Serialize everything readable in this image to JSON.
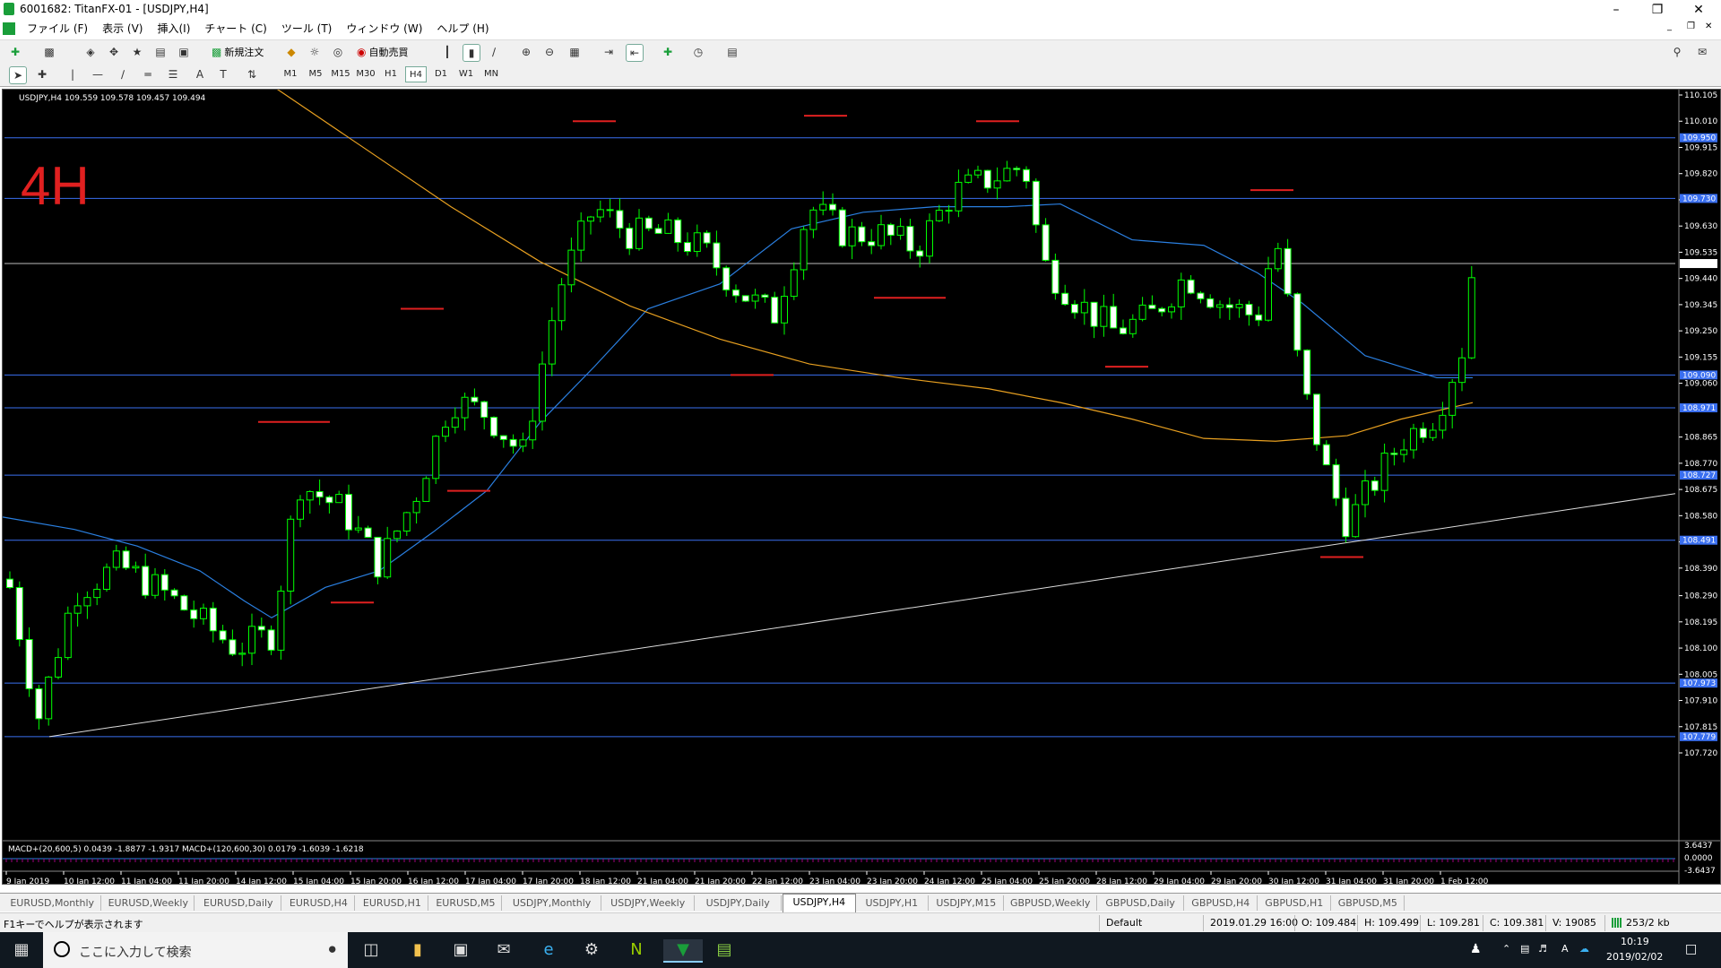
{
  "window": {
    "title": "6001682: TitanFX-01 - [USDJPY,H4]"
  },
  "menu": [
    "ファイル (F)",
    "表示 (V)",
    "挿入(I)",
    "チャート (C)",
    "ツール (T)",
    "ウィンドウ (W)",
    "ヘルプ (H)"
  ],
  "toolbar": {
    "new_order": "新規注文",
    "auto_trade": "自動売買"
  },
  "timeframes": [
    "M1",
    "M5",
    "M15",
    "M30",
    "H1",
    "H4",
    "D1",
    "W1",
    "MN"
  ],
  "active_timeframe": "H4",
  "chart": {
    "header": "USDJPY,H4  109.559 109.578 109.457 109.494",
    "overlay_text": "4H",
    "overlay_color": "#e02020",
    "macd_header": "MACD+(20,600,5) 0.0439 -1.8877 -1.9317  MACD+(120,600,30) 0.0179 -1.6039 -1.6218",
    "bull_color": "#00ff00",
    "bear_color": "#00ff00",
    "price_axis": [
      "110.105",
      "110.010",
      "109.915",
      "109.820",
      "109.725",
      "109.630",
      "109.535",
      "109.440",
      "109.345",
      "109.250",
      "109.155",
      "109.060",
      "108.865",
      "108.770",
      "108.675",
      "108.580",
      "108.485",
      "108.390",
      "108.290",
      "108.195",
      "108.100",
      "108.005",
      "107.910",
      "107.815",
      "107.720"
    ],
    "hlines": [
      {
        "price": "109.950"
      },
      {
        "price": "109.730"
      },
      {
        "price": "109.494"
      },
      {
        "price": "109.090"
      },
      {
        "price": "108.971"
      },
      {
        "price": "108.727"
      },
      {
        "price": "108.491"
      },
      {
        "price": "107.973"
      },
      {
        "price": "107.779"
      }
    ],
    "macd_axis": [
      "3.6437",
      "0.0000",
      "-3.6437"
    ],
    "time_axis": [
      "9 Jan 2019",
      "10 Jan 12:00",
      "11 Jan 04:00",
      "11 Jan 20:00",
      "14 Jan 12:00",
      "15 Jan 04:00",
      "15 Jan 20:00",
      "16 Jan 12:00",
      "17 Jan 04:00",
      "17 Jan 20:00",
      "18 Jan 12:00",
      "21 Jan 04:00",
      "21 Jan 20:00",
      "22 Jan 12:00",
      "23 Jan 04:00",
      "23 Jan 20:00",
      "24 Jan 12:00",
      "25 Jan 04:00",
      "25 Jan 20:00",
      "28 Jan 12:00",
      "29 Jan 04:00",
      "29 Jan 20:00",
      "30 Jan 12:00",
      "31 Jan 04:00",
      "31 Jan 20:00",
      "1 Feb 12:00"
    ]
  },
  "tabs": [
    "EURUSD,Monthly",
    "EURUSD,Weekly",
    "EURUSD,Daily",
    "EURUSD,H4",
    "EURUSD,H1",
    "EURUSD,M5",
    "USDJPY,Monthly",
    "USDJPY,Weekly",
    "USDJPY,Daily",
    "USDJPY,H4",
    "USDJPY,H1",
    "USDJPY,M15",
    "GBPUSD,Weekly",
    "GBPUSD,Daily",
    "GBPUSD,H4",
    "GBPUSD,H1",
    "GBPUSD,M5"
  ],
  "active_tab": "USDJPY,H4",
  "status": {
    "help": "F1キーでヘルプが表示されます",
    "profile": "Default",
    "datetime": "2019.01.29 16:00",
    "open": "O: 109.484",
    "high": "H: 109.499",
    "low": "L: 109.281",
    "close": "C: 109.381",
    "volume": "V: 19085",
    "traffic": "253/2 kb"
  },
  "taskbar": {
    "search_placeholder": "ここに入力して検索",
    "time": "10:19",
    "date": "2019/02/02"
  }
}
